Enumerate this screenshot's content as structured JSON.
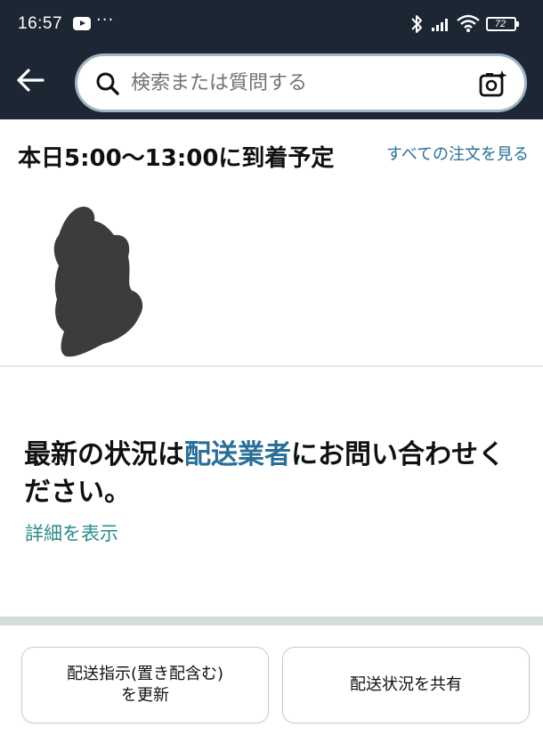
{
  "status_bar": {
    "time": "16:57",
    "more": "···",
    "battery": "72"
  },
  "header": {
    "search_placeholder": "検索または質問する"
  },
  "delivery": {
    "title": "本日5:00〜13:00に到着予定",
    "all_orders_link": "すべての注文を見る",
    "status_prefix": "最新の状況は",
    "carrier_link": "配送業者",
    "status_suffix": "にお問い合わせください。",
    "details_link": "詳細を表示"
  },
  "actions": {
    "update_label": "配送指示(置き配含む)\nを更新",
    "share_label": "配送状況を共有"
  }
}
